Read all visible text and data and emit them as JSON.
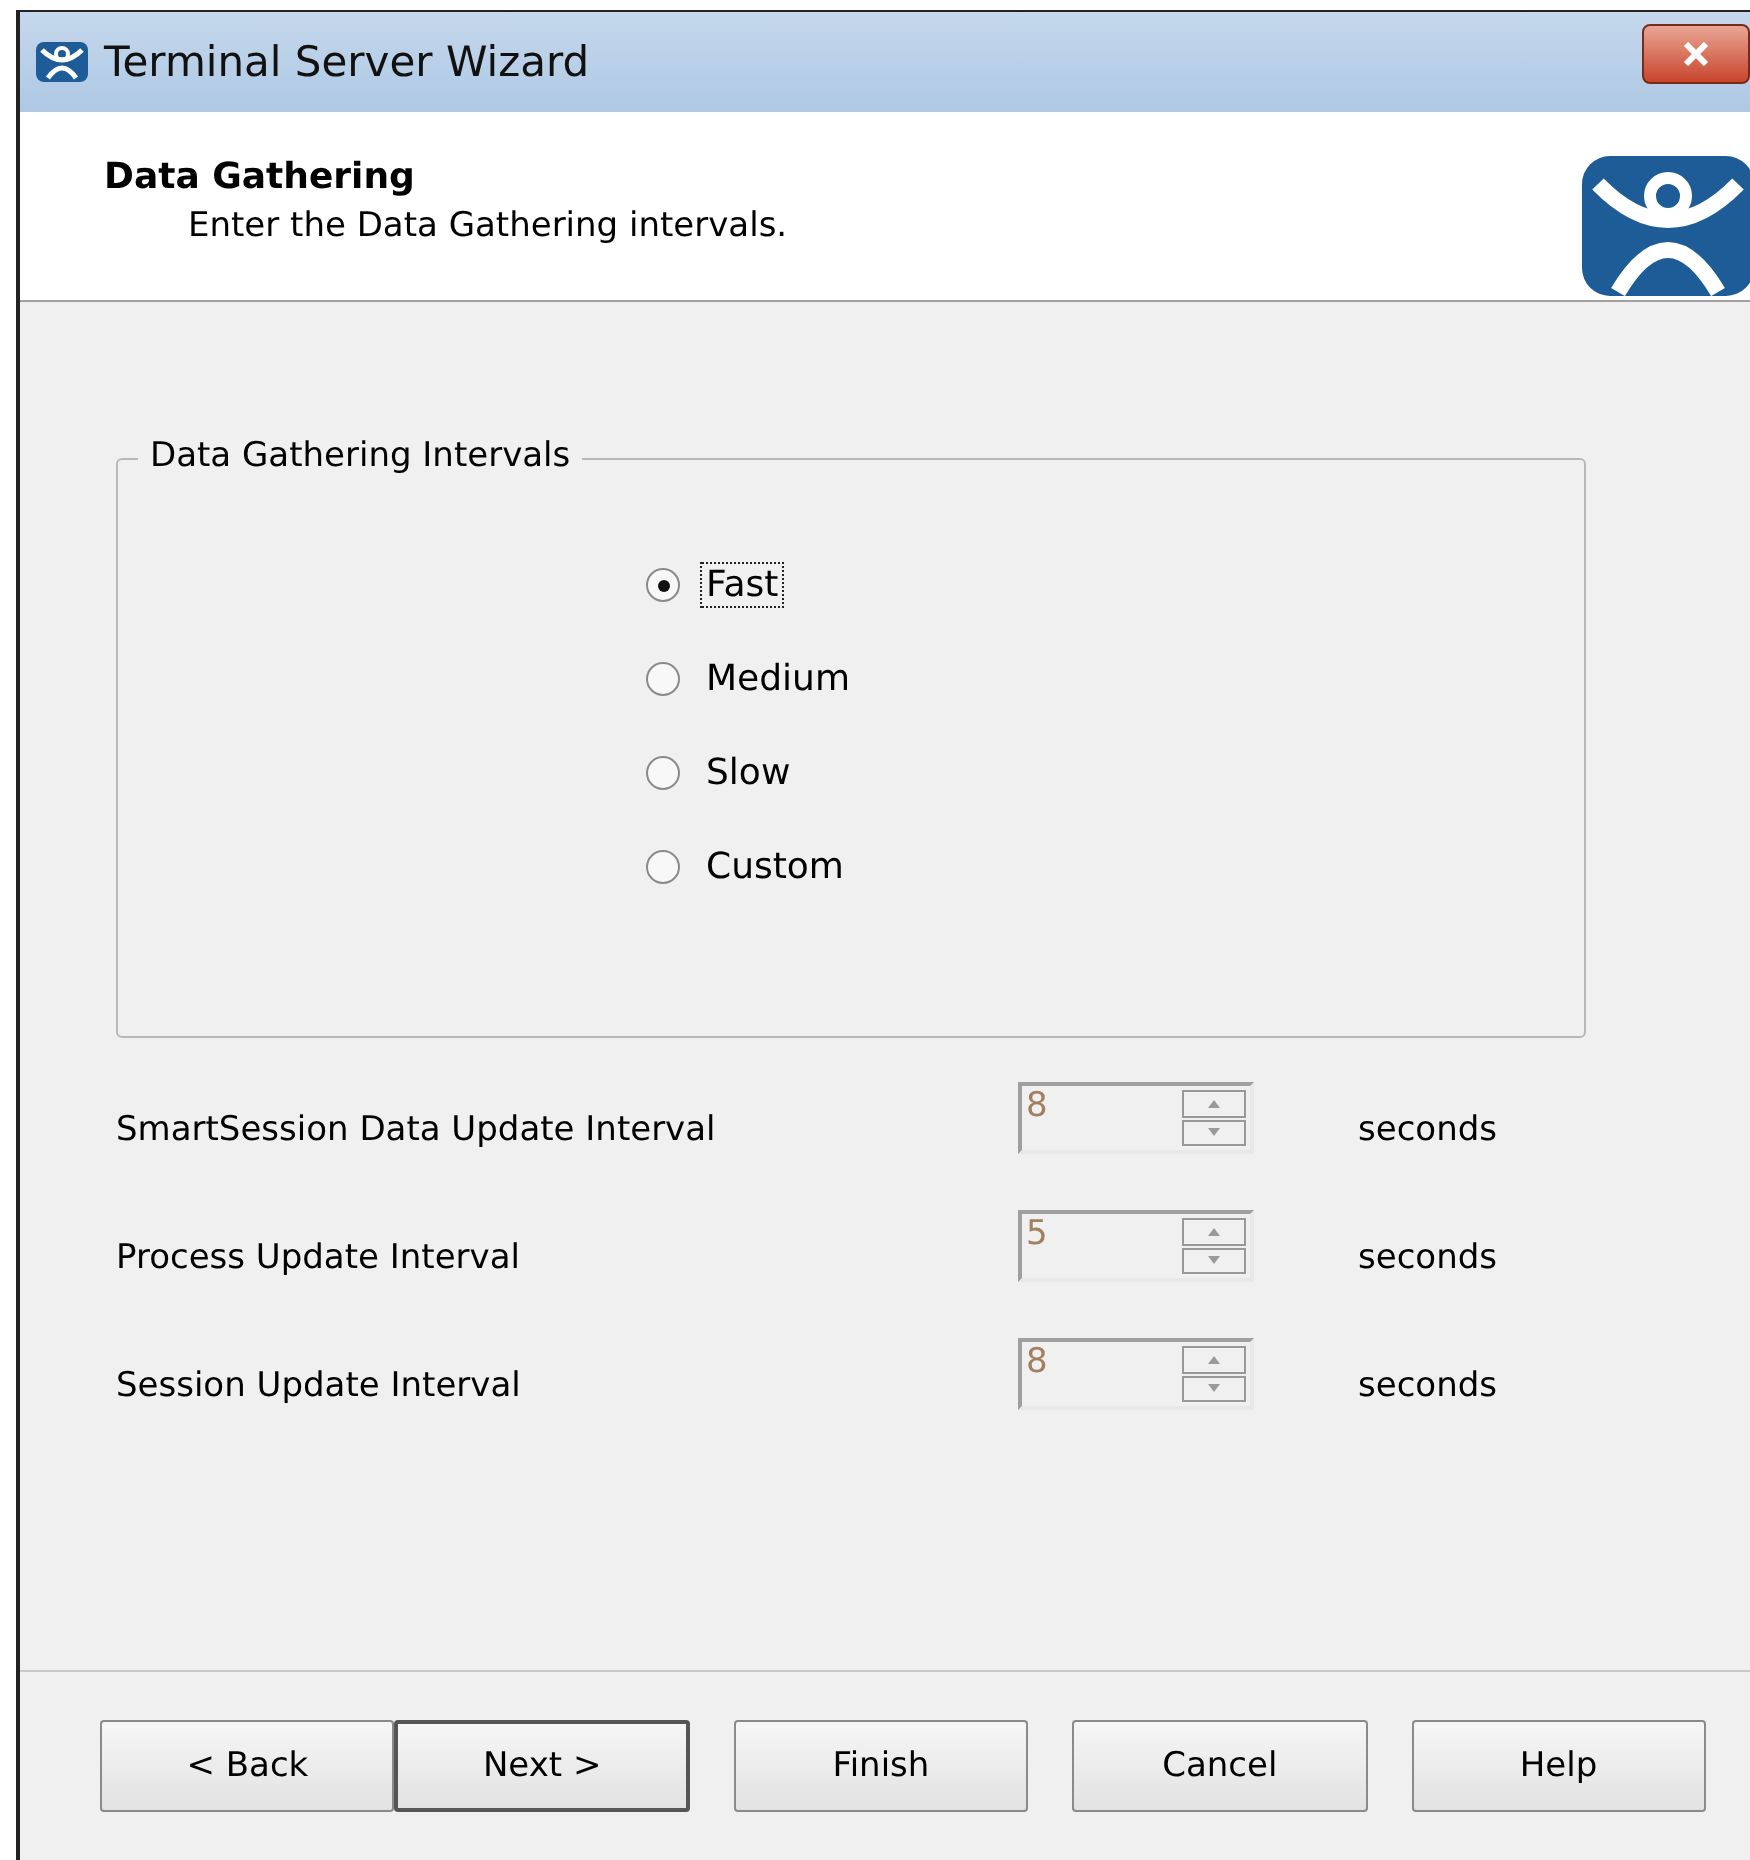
{
  "window": {
    "title": "Terminal Server Wizard"
  },
  "header": {
    "title": "Data Gathering",
    "subtitle": "Enter the Data Gathering intervals."
  },
  "group": {
    "title": "Data Gathering Intervals",
    "options": [
      {
        "label": "Fast",
        "selected": true
      },
      {
        "label": "Medium",
        "selected": false
      },
      {
        "label": "Slow",
        "selected": false
      },
      {
        "label": "Custom",
        "selected": false
      }
    ]
  },
  "intervals": [
    {
      "label": "SmartSession Data Update Interval",
      "value": "8",
      "unit": "seconds",
      "disabled": true
    },
    {
      "label": "Process Update Interval",
      "value": "5",
      "unit": "seconds",
      "disabled": true
    },
    {
      "label": "Session Update Interval",
      "value": "8",
      "unit": "seconds",
      "disabled": true
    }
  ],
  "buttons": [
    {
      "label": "< Back",
      "default": false
    },
    {
      "label": "Next >",
      "default": true
    },
    {
      "label": "Finish",
      "default": false
    },
    {
      "label": "Cancel",
      "default": false
    },
    {
      "label": "Help",
      "default": false
    }
  ]
}
